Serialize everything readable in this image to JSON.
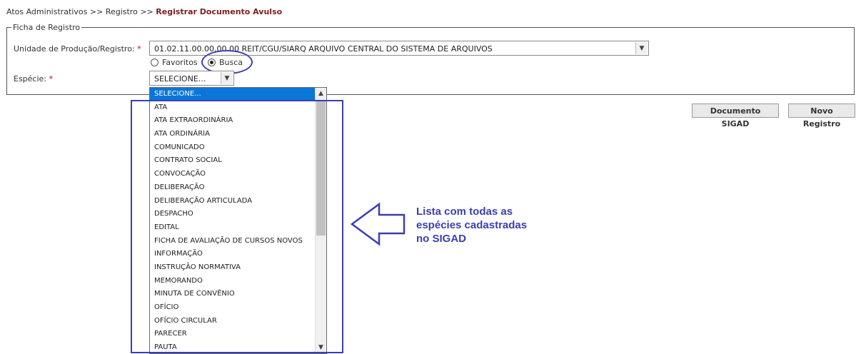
{
  "breadcrumb": {
    "items": [
      "Atos Administrativos",
      "Registro"
    ],
    "separator": ">>",
    "current": "Registrar Documento Avulso"
  },
  "form": {
    "legend": "Ficha de Registro",
    "unidade_label": "Unidade de Produção/Registro:",
    "required_mark": "*",
    "unidade_value": "01.02.11.00.00.00.00 REIT/CGU/SIARQ ARQUIVO CENTRAL DO SISTEMA DE ARQUIVOS",
    "radio_favoritos": "Favoritos",
    "radio_busca": "Busca",
    "especie_label": "Espécie:",
    "especie_value": "SELECIONE..."
  },
  "buttons": {
    "documento_sigad": "Documento SIGAD",
    "novo_registro": "Novo Registro"
  },
  "dropdown": {
    "options": [
      "SELECIONE...",
      "ATA",
      "ATA EXTRAORDINÁRIA",
      "ATA ORDINÁRIA",
      "COMUNICADO",
      "CONTRATO SOCIAL",
      "CONVOCAÇÃO",
      "DELIBERAÇÃO",
      "DELIBERAÇÃO ARTICULADA",
      "DESPACHO",
      "EDITAL",
      "FICHA DE AVALIAÇÃO DE CURSOS NOVOS",
      "INFORMAÇÃO",
      "INSTRUÇÃO NORMATIVA",
      "MEMORANDO",
      "MINUTA DE CONVÊNIO",
      "OFÍCIO",
      "OFÍCIO CIRCULAR",
      "PARECER",
      "PAUTA"
    ]
  },
  "annotation": {
    "lines": [
      "Lista com todas as",
      "espécies cadastradas",
      "no SIGAD"
    ],
    "color": "#3a3fb0"
  },
  "icons": {
    "select_arrow": "chevron-down-icon",
    "scroll_up": "chevron-up-icon",
    "scroll_down": "chevron-down-icon",
    "annotation_arrow": "left-arrow-icon"
  }
}
